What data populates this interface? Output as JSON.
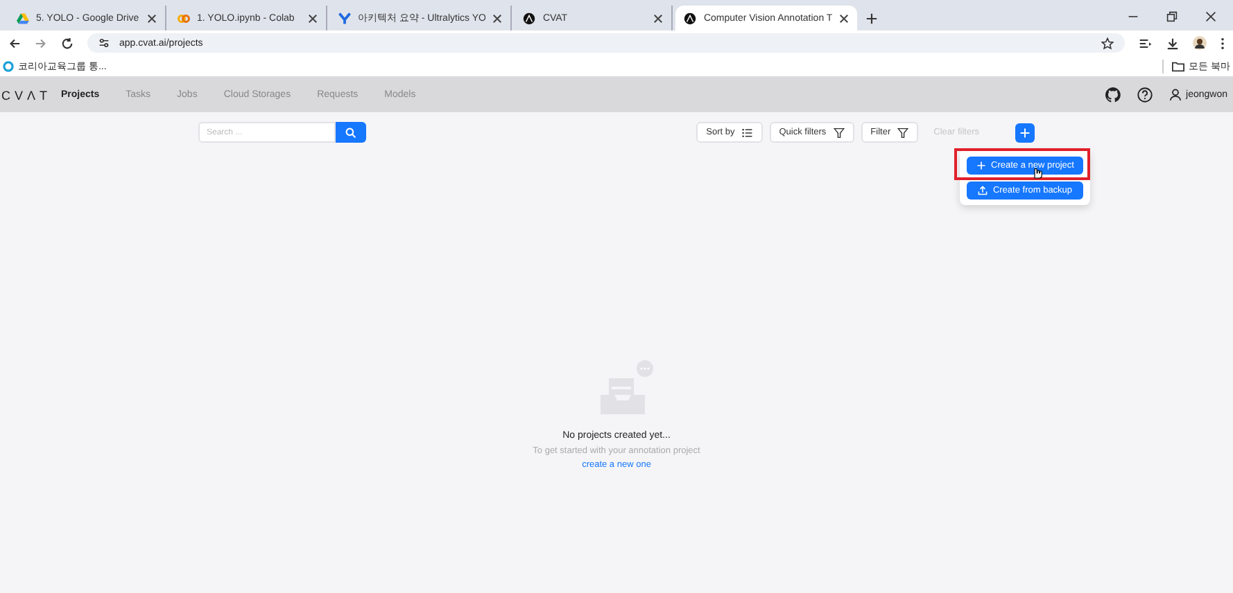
{
  "browser": {
    "tabs": [
      {
        "title": "5. YOLO - Google Drive",
        "kind": "drive",
        "selected": false
      },
      {
        "title": "1. YOLO.ipynb - Colab",
        "kind": "colab",
        "selected": false
      },
      {
        "title": "아키텍처 요약 - Ultralytics YO",
        "kind": "ultralytics",
        "selected": false
      },
      {
        "title": "CVAT",
        "kind": "cvat",
        "selected": false
      },
      {
        "title": "Computer Vision Annotation T",
        "kind": "cvat",
        "selected": true
      }
    ],
    "url": "app.cvat.ai/projects",
    "bookmarks": [
      "코리아교육그룹 통..."
    ],
    "all_bookmarks": "모든 북마"
  },
  "app": {
    "logo": "CVΛT",
    "nav": [
      {
        "label": "Projects",
        "selected": true
      },
      {
        "label": "Tasks",
        "selected": false
      },
      {
        "label": "Jobs",
        "selected": false
      },
      {
        "label": "Cloud Storages",
        "selected": false
      },
      {
        "label": "Requests",
        "selected": false
      },
      {
        "label": "Models",
        "selected": false
      }
    ],
    "user": "jeongwon",
    "search": {
      "placeholder": "Search ..."
    },
    "toolbar": [
      {
        "label": "Sort by",
        "kind": "sort",
        "disabled": false
      },
      {
        "label": "Quick filters",
        "kind": "filter",
        "disabled": false
      },
      {
        "label": "Filter",
        "kind": "filter",
        "disabled": false
      },
      {
        "label": "Clear filters",
        "kind": "plain",
        "disabled": true
      }
    ],
    "create_menu": {
      "expanded": true,
      "items": [
        {
          "label": "Create a new project",
          "kind": "plus",
          "highlighted": true
        },
        {
          "label": "Create from backup",
          "kind": "upload",
          "highlighted": false
        }
      ]
    },
    "empty_state": {
      "title": "No projects created yet...",
      "text": "To get started with your annotation project",
      "link": "create a new one"
    }
  }
}
